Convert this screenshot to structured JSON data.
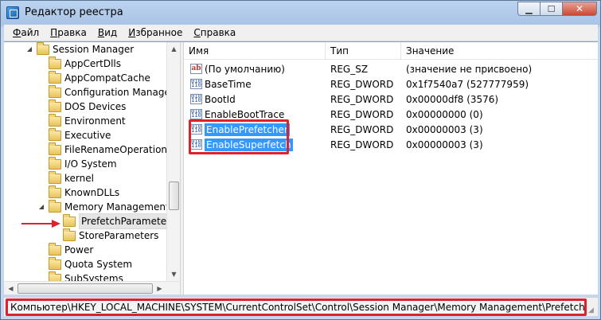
{
  "window": {
    "title": "Редактор реестра"
  },
  "menu": [
    {
      "u": "Ф",
      "rest": "айл"
    },
    {
      "u": "П",
      "rest": "равка"
    },
    {
      "u": "В",
      "rest": "ид"
    },
    {
      "u": "И",
      "rest": "збранное"
    },
    {
      "u": "С",
      "rest": "правка"
    }
  ],
  "tree": {
    "items": [
      {
        "label": "Session Manager",
        "expanded": true
      },
      {
        "label": "AppCertDlls"
      },
      {
        "label": "AppCompatCache"
      },
      {
        "label": "Configuration Manager"
      },
      {
        "label": "DOS Devices"
      },
      {
        "label": "Environment"
      },
      {
        "label": "Executive"
      },
      {
        "label": "FileRenameOperations"
      },
      {
        "label": "I/O System"
      },
      {
        "label": "kernel"
      },
      {
        "label": "KnownDLLs"
      },
      {
        "label": "Memory Management",
        "expanded": true
      },
      {
        "label": "PrefetchParameters",
        "selected": true
      },
      {
        "label": "StoreParameters"
      },
      {
        "label": "Power"
      },
      {
        "label": "Quota System"
      },
      {
        "label": "SubSystems"
      }
    ]
  },
  "list": {
    "headers": {
      "name": "Имя",
      "type": "Тип",
      "value": "Значение"
    },
    "rows": [
      {
        "icon": "ab",
        "name": "(По умолчанию)",
        "type": "REG_SZ",
        "value": "(значение не присвоено)"
      },
      {
        "icon": "bin",
        "name": "BaseTime",
        "type": "REG_DWORD",
        "value": "0x1f7540a7 (527777959)"
      },
      {
        "icon": "bin",
        "name": "BootId",
        "type": "REG_DWORD",
        "value": "0x00000df8 (3576)"
      },
      {
        "icon": "bin",
        "name": "EnableBootTrace",
        "type": "REG_DWORD",
        "value": "0x00000000 (0)"
      },
      {
        "icon": "bin",
        "name": "EnablePrefetcher",
        "type": "REG_DWORD",
        "value": "0x00000003 (3)",
        "selected": true
      },
      {
        "icon": "bin",
        "name": "EnableSuperfetch",
        "type": "REG_DWORD",
        "value": "0x00000003 (3)",
        "selected": true
      }
    ]
  },
  "status": {
    "path": "Компьютер\\HKEY_LOCAL_MACHINE\\SYSTEM\\CurrentControlSet\\Control\\Session Manager\\Memory Management\\PrefetchParameters"
  },
  "colors": {
    "selection": "#3399ff",
    "highlight": "#e0202a"
  }
}
